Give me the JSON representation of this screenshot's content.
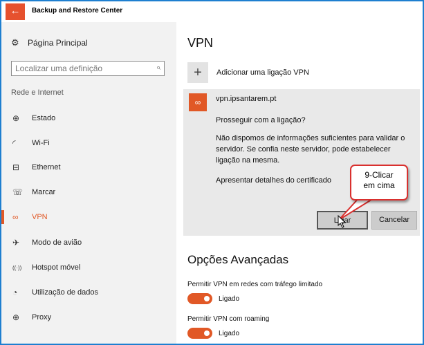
{
  "window": {
    "title": "Backup and Restore Center",
    "back_glyph": "←"
  },
  "sidebar": {
    "home_label": "Página Principal",
    "search_placeholder": "Localizar uma definição",
    "section_title": "Rede e Internet",
    "items": [
      {
        "label": "Estado",
        "icon": "globe-icon",
        "glyph": "⊕"
      },
      {
        "label": "Wi-Fi",
        "icon": "wifi-icon",
        "glyph": "◜"
      },
      {
        "label": "Ethernet",
        "icon": "ethernet-icon",
        "glyph": "⊟"
      },
      {
        "label": "Marcar",
        "icon": "dialup-icon",
        "glyph": "☏"
      },
      {
        "label": "VPN",
        "icon": "vpn-icon",
        "glyph": "∞",
        "active": true
      },
      {
        "label": "Modo de avião",
        "icon": "airplane-icon",
        "glyph": "✈"
      },
      {
        "label": "Hotspot móvel",
        "icon": "hotspot-icon",
        "glyph": "((·))"
      },
      {
        "label": "Utilização de dados",
        "icon": "data-usage-icon",
        "glyph": "◔"
      },
      {
        "label": "Proxy",
        "icon": "proxy-icon",
        "glyph": "⊕"
      }
    ]
  },
  "main": {
    "heading": "VPN",
    "add_label": "Adicionar uma ligação VPN",
    "connection": {
      "name": "vpn.ipsantarem.pt",
      "question": "Prosseguir com a ligação?",
      "message": "Não dispomos de informações suficientes para validar o servidor. Se confia neste servidor, pode estabelecer ligação na mesma.",
      "details_label": "Apresentar detalhes do certificado",
      "connect_label": "Ligar",
      "cancel_label": "Cancelar"
    },
    "advanced_heading": "Opções Avançadas",
    "options": [
      {
        "label": "Permitir VPN em redes com tráfego limitado",
        "state": "Ligado",
        "on": true
      },
      {
        "label": "Permitir VPN com roaming",
        "state": "Ligado",
        "on": true
      }
    ]
  },
  "annotation": {
    "line1": "9-Clicar",
    "line2": "em cima"
  },
  "colors": {
    "accent": "#e15826",
    "frame": "#1e7fd0",
    "callout_border": "#d9302e"
  }
}
